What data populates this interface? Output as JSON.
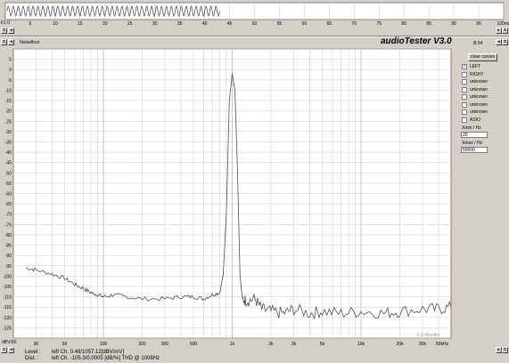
{
  "window": {
    "title": "audioTester V3.0",
    "version": "B.54",
    "noisefloor_label": "Noisefloor"
  },
  "top_scope": {
    "unit_label": "F1 0",
    "x_ticks": [
      "5",
      "10",
      "15",
      "20",
      "25",
      "30",
      "35",
      "40",
      "45",
      "50",
      "55",
      "60",
      "65",
      "70",
      "75",
      "80",
      "85",
      "90",
      "95",
      "100ms"
    ],
    "lock_symbol": "±"
  },
  "spectrum": {
    "y_unit_label": "dBV/20",
    "x_ticks": [
      "30",
      "50",
      "100",
      "200",
      "300",
      "500",
      "1k",
      "2k",
      "3k",
      "5k",
      "10k",
      "20k",
      "30k",
      "50kHz"
    ],
    "y_ticks": [
      "5",
      "0",
      "-5",
      "-10",
      "-15",
      "-20",
      "-25",
      "-30",
      "-35",
      "-40",
      "-45",
      "-50",
      "-55",
      "-60",
      "-65",
      "-70",
      "-75",
      "-80",
      "-85",
      "-90",
      "-95",
      "-100",
      "-105",
      "-110",
      "-115",
      "-120",
      "-125"
    ],
    "watermark": "© D.Mueller",
    "lock_symbol": "±"
  },
  "side_panel": {
    "clear_button": "clear curves",
    "channels": [
      {
        "label": "LEFT",
        "checked": true
      },
      {
        "label": "RIGHT",
        "checked": false
      },
      {
        "label": "unknown",
        "checked": false
      },
      {
        "label": "unknown",
        "checked": false
      },
      {
        "label": "unknown",
        "checked": false
      },
      {
        "label": "unknown",
        "checked": false
      },
      {
        "label": "unknown",
        "checked": false
      },
      {
        "label": "ASIO",
        "checked": false
      }
    ],
    "xmin_label": "Xmin / Hz",
    "xmin_value": "20",
    "xmax_label": "Xmax / Hz",
    "xmax_value": "50000"
  },
  "status": {
    "level_label": "Level :",
    "level_value": "left Ch. 0.48/1057.12[dBV/mV]",
    "dist_label": "Dist. :",
    "dist_value": "left Ch. -105.3/0.0005 [dB/%] THD @ 1008Hz"
  },
  "chart_data": [
    {
      "type": "line",
      "title": "",
      "xlabel": "",
      "ylabel": "",
      "xlim": [
        0,
        100
      ],
      "description_of_signal": "",
      "series": [
        {
          "name": "",
          "frequency_cycles": 43,
          "x_range": [
            0,
            43
          ]
        }
      ]
    },
    {
      "type": "line",
      "title": "",
      "xscale": "log",
      "xlim": [
        20,
        50000
      ],
      "ylim": [
        -130,
        10
      ],
      "ylabel": "dBV/20",
      "grid": true,
      "series": [
        {
          "name": "",
          "x": [
            25,
            30,
            40,
            50,
            60,
            70,
            80,
            90,
            100,
            120,
            150,
            200,
            300,
            400,
            500,
            600,
            700,
            800,
            850,
            900,
            950,
            1000,
            1050,
            1100,
            1150,
            1200,
            1300,
            1500,
            1700,
            2000,
            2500,
            3000,
            4000,
            5000,
            7000,
            10000,
            15000,
            20000,
            30000,
            40000,
            50000
          ],
          "y": [
            -96,
            -97,
            -99,
            -101,
            -104,
            -106,
            -108,
            -109,
            -110,
            -109,
            -110,
            -111,
            -111,
            -110,
            -110,
            -111,
            -109,
            -108,
            -100,
            -70,
            -15,
            -2,
            -10,
            -50,
            -100,
            -111,
            -112,
            -111,
            -116,
            -117,
            -118,
            -116,
            -118,
            -117,
            -118,
            -117,
            -118,
            -117,
            -116,
            -116,
            -115
          ]
        }
      ]
    }
  ]
}
